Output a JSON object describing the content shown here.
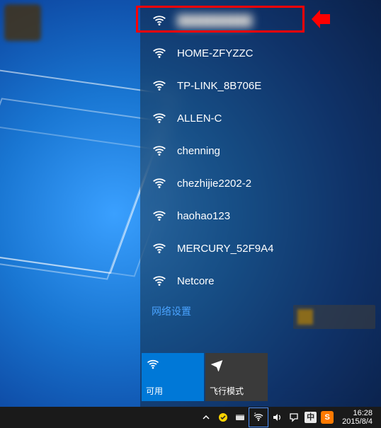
{
  "annotation": {
    "highlight": "selected-network",
    "arrow_color": "#ff0000"
  },
  "flyout": {
    "networks": [
      {
        "ssid": "██████████",
        "redacted": true
      },
      {
        "ssid": "HOME-ZFYZZC"
      },
      {
        "ssid": "TP-LINK_8B706E"
      },
      {
        "ssid": "ALLEN-C"
      },
      {
        "ssid": "chenning"
      },
      {
        "ssid": "chezhijie2202-2"
      },
      {
        "ssid": "haohao123"
      },
      {
        "ssid": "MERCURY_52F9A4"
      },
      {
        "ssid": "Netcore"
      }
    ],
    "settings_label": "网络设置",
    "tiles": {
      "wifi": {
        "label": "可用",
        "state": "on"
      },
      "airplane": {
        "label": "飞行模式",
        "state": "off"
      }
    }
  },
  "taskbar": {
    "ime_label": "中",
    "sogou_label": "S",
    "clock_time": "16:28",
    "clock_date": "2015/8/4"
  },
  "colors": {
    "accent": "#0078d7",
    "highlight": "#ff0000",
    "link": "#4aa3ff"
  }
}
